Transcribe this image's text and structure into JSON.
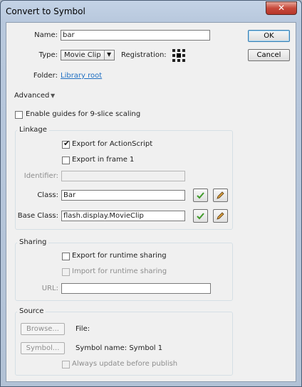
{
  "window": {
    "title": "Convert to Symbol",
    "close_glyph": "✕"
  },
  "name": {
    "label": "Name:",
    "value": "bar"
  },
  "type": {
    "label": "Type:",
    "value": "Movie Clip",
    "arrow": "▼"
  },
  "registration": {
    "label": "Registration:"
  },
  "folder": {
    "label": "Folder:",
    "value": "Library root"
  },
  "buttons": {
    "ok": "OK",
    "cancel": "Cancel"
  },
  "advanced": {
    "label": "Advanced",
    "arrow": "▼"
  },
  "nine_slice": {
    "label": "Enable guides for 9-slice scaling"
  },
  "linkage": {
    "title": "Linkage",
    "export_actionscript": "Export for ActionScript",
    "export_frame1": "Export in frame 1",
    "identifier_label": "Identifier:",
    "class_label": "Class:",
    "class_value": "Bar",
    "base_class_label": "Base Class:",
    "base_class_value": "flash.display.MovieClip"
  },
  "sharing": {
    "title": "Sharing",
    "export_runtime": "Export for runtime sharing",
    "import_runtime": "Import for runtime sharing",
    "url_label": "URL:"
  },
  "source": {
    "title": "Source",
    "browse": "Browse...",
    "file_label": "File:",
    "symbol_button": "Symbol...",
    "symbol_name": "Symbol name: Symbol 1",
    "always_update": "Always update before publish"
  },
  "icons": {
    "check": "check-icon",
    "pencil": "pencil-icon",
    "registration": "registration-grid-icon"
  }
}
